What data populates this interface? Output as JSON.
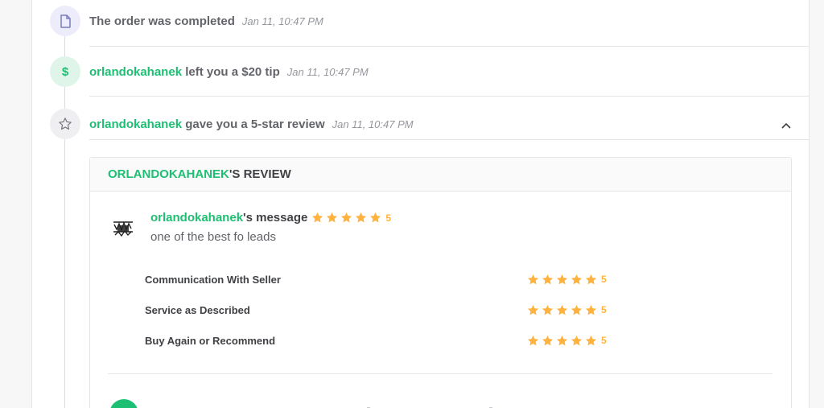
{
  "events": [
    {
      "icon": "document-icon",
      "text": "The order was completed",
      "time": "Jan 11, 10:47 PM"
    },
    {
      "icon": "dollar-icon",
      "user": "orlandokahanek",
      "text": " left you a $20 tip",
      "time": "Jan 11, 10:47 PM"
    },
    {
      "icon": "star-outline-icon",
      "user": "orlandokahanek",
      "text": " gave you a 5-star review",
      "time": "Jan 11, 10:47 PM"
    }
  ],
  "review": {
    "title_user": "ORLANDOKAHANEK",
    "title_suffix": "'S REVIEW",
    "message_user": "orlandokahanek",
    "message_suffix": "'s message",
    "overall_score": "5",
    "overall_rating": 5,
    "message": "one of the best fo leads",
    "ratings": [
      {
        "label": "Communication With Seller",
        "score": "5",
        "rating": 5
      },
      {
        "label": "Service as Described",
        "score": "5",
        "rating": 5
      },
      {
        "label": "Buy Again or Recommend",
        "score": "5",
        "rating": 5
      }
    ]
  },
  "colors": {
    "accent": "#1dbf73",
    "star": "#ffb33e",
    "text": "#404145",
    "muted": "#95979d"
  }
}
